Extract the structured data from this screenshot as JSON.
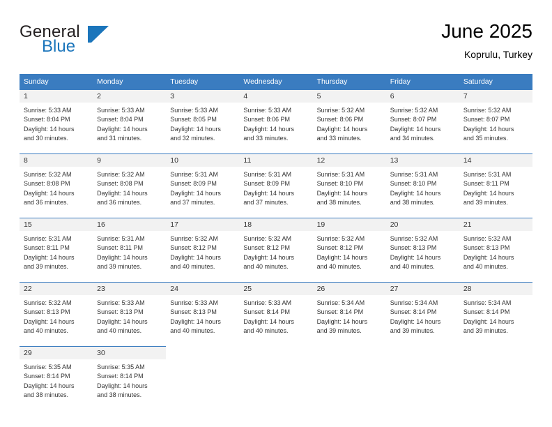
{
  "brand": {
    "name_part1": "General",
    "name_part2": "Blue",
    "logo_icon": "triangle-flag-icon",
    "color_blue": "#1b75bb",
    "color_dark": "#231f20"
  },
  "header": {
    "title": "June 2025",
    "location": "Koprulu, Turkey"
  },
  "calendar": {
    "header_bg": "#3a7cc0",
    "daynum_bg": "#f2f2f2",
    "weekday_headers": [
      "Sunday",
      "Monday",
      "Tuesday",
      "Wednesday",
      "Thursday",
      "Friday",
      "Saturday"
    ],
    "weeks": [
      [
        {
          "day": "1",
          "sunrise": "Sunrise: 5:33 AM",
          "sunset": "Sunset: 8:04 PM",
          "daylight1": "Daylight: 14 hours",
          "daylight2": "and 30 minutes."
        },
        {
          "day": "2",
          "sunrise": "Sunrise: 5:33 AM",
          "sunset": "Sunset: 8:04 PM",
          "daylight1": "Daylight: 14 hours",
          "daylight2": "and 31 minutes."
        },
        {
          "day": "3",
          "sunrise": "Sunrise: 5:33 AM",
          "sunset": "Sunset: 8:05 PM",
          "daylight1": "Daylight: 14 hours",
          "daylight2": "and 32 minutes."
        },
        {
          "day": "4",
          "sunrise": "Sunrise: 5:33 AM",
          "sunset": "Sunset: 8:06 PM",
          "daylight1": "Daylight: 14 hours",
          "daylight2": "and 33 minutes."
        },
        {
          "day": "5",
          "sunrise": "Sunrise: 5:32 AM",
          "sunset": "Sunset: 8:06 PM",
          "daylight1": "Daylight: 14 hours",
          "daylight2": "and 33 minutes."
        },
        {
          "day": "6",
          "sunrise": "Sunrise: 5:32 AM",
          "sunset": "Sunset: 8:07 PM",
          "daylight1": "Daylight: 14 hours",
          "daylight2": "and 34 minutes."
        },
        {
          "day": "7",
          "sunrise": "Sunrise: 5:32 AM",
          "sunset": "Sunset: 8:07 PM",
          "daylight1": "Daylight: 14 hours",
          "daylight2": "and 35 minutes."
        }
      ],
      [
        {
          "day": "8",
          "sunrise": "Sunrise: 5:32 AM",
          "sunset": "Sunset: 8:08 PM",
          "daylight1": "Daylight: 14 hours",
          "daylight2": "and 36 minutes."
        },
        {
          "day": "9",
          "sunrise": "Sunrise: 5:32 AM",
          "sunset": "Sunset: 8:08 PM",
          "daylight1": "Daylight: 14 hours",
          "daylight2": "and 36 minutes."
        },
        {
          "day": "10",
          "sunrise": "Sunrise: 5:31 AM",
          "sunset": "Sunset: 8:09 PM",
          "daylight1": "Daylight: 14 hours",
          "daylight2": "and 37 minutes."
        },
        {
          "day": "11",
          "sunrise": "Sunrise: 5:31 AM",
          "sunset": "Sunset: 8:09 PM",
          "daylight1": "Daylight: 14 hours",
          "daylight2": "and 37 minutes."
        },
        {
          "day": "12",
          "sunrise": "Sunrise: 5:31 AM",
          "sunset": "Sunset: 8:10 PM",
          "daylight1": "Daylight: 14 hours",
          "daylight2": "and 38 minutes."
        },
        {
          "day": "13",
          "sunrise": "Sunrise: 5:31 AM",
          "sunset": "Sunset: 8:10 PM",
          "daylight1": "Daylight: 14 hours",
          "daylight2": "and 38 minutes."
        },
        {
          "day": "14",
          "sunrise": "Sunrise: 5:31 AM",
          "sunset": "Sunset: 8:11 PM",
          "daylight1": "Daylight: 14 hours",
          "daylight2": "and 39 minutes."
        }
      ],
      [
        {
          "day": "15",
          "sunrise": "Sunrise: 5:31 AM",
          "sunset": "Sunset: 8:11 PM",
          "daylight1": "Daylight: 14 hours",
          "daylight2": "and 39 minutes."
        },
        {
          "day": "16",
          "sunrise": "Sunrise: 5:31 AM",
          "sunset": "Sunset: 8:11 PM",
          "daylight1": "Daylight: 14 hours",
          "daylight2": "and 39 minutes."
        },
        {
          "day": "17",
          "sunrise": "Sunrise: 5:32 AM",
          "sunset": "Sunset: 8:12 PM",
          "daylight1": "Daylight: 14 hours",
          "daylight2": "and 40 minutes."
        },
        {
          "day": "18",
          "sunrise": "Sunrise: 5:32 AM",
          "sunset": "Sunset: 8:12 PM",
          "daylight1": "Daylight: 14 hours",
          "daylight2": "and 40 minutes."
        },
        {
          "day": "19",
          "sunrise": "Sunrise: 5:32 AM",
          "sunset": "Sunset: 8:12 PM",
          "daylight1": "Daylight: 14 hours",
          "daylight2": "and 40 minutes."
        },
        {
          "day": "20",
          "sunrise": "Sunrise: 5:32 AM",
          "sunset": "Sunset: 8:13 PM",
          "daylight1": "Daylight: 14 hours",
          "daylight2": "and 40 minutes."
        },
        {
          "day": "21",
          "sunrise": "Sunrise: 5:32 AM",
          "sunset": "Sunset: 8:13 PM",
          "daylight1": "Daylight: 14 hours",
          "daylight2": "and 40 minutes."
        }
      ],
      [
        {
          "day": "22",
          "sunrise": "Sunrise: 5:32 AM",
          "sunset": "Sunset: 8:13 PM",
          "daylight1": "Daylight: 14 hours",
          "daylight2": "and 40 minutes."
        },
        {
          "day": "23",
          "sunrise": "Sunrise: 5:33 AM",
          "sunset": "Sunset: 8:13 PM",
          "daylight1": "Daylight: 14 hours",
          "daylight2": "and 40 minutes."
        },
        {
          "day": "24",
          "sunrise": "Sunrise: 5:33 AM",
          "sunset": "Sunset: 8:13 PM",
          "daylight1": "Daylight: 14 hours",
          "daylight2": "and 40 minutes."
        },
        {
          "day": "25",
          "sunrise": "Sunrise: 5:33 AM",
          "sunset": "Sunset: 8:14 PM",
          "daylight1": "Daylight: 14 hours",
          "daylight2": "and 40 minutes."
        },
        {
          "day": "26",
          "sunrise": "Sunrise: 5:34 AM",
          "sunset": "Sunset: 8:14 PM",
          "daylight1": "Daylight: 14 hours",
          "daylight2": "and 39 minutes."
        },
        {
          "day": "27",
          "sunrise": "Sunrise: 5:34 AM",
          "sunset": "Sunset: 8:14 PM",
          "daylight1": "Daylight: 14 hours",
          "daylight2": "and 39 minutes."
        },
        {
          "day": "28",
          "sunrise": "Sunrise: 5:34 AM",
          "sunset": "Sunset: 8:14 PM",
          "daylight1": "Daylight: 14 hours",
          "daylight2": "and 39 minutes."
        }
      ],
      [
        {
          "day": "29",
          "sunrise": "Sunrise: 5:35 AM",
          "sunset": "Sunset: 8:14 PM",
          "daylight1": "Daylight: 14 hours",
          "daylight2": "and 38 minutes."
        },
        {
          "day": "30",
          "sunrise": "Sunrise: 5:35 AM",
          "sunset": "Sunset: 8:14 PM",
          "daylight1": "Daylight: 14 hours",
          "daylight2": "and 38 minutes."
        },
        null,
        null,
        null,
        null,
        null
      ]
    ]
  }
}
